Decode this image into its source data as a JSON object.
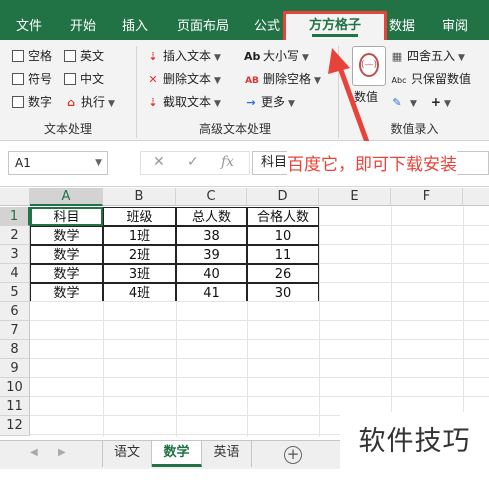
{
  "ribbon_tabs": [
    "文件",
    "开始",
    "插入",
    "页面布局",
    "公式",
    "方方格子",
    "数据",
    "审阅"
  ],
  "text_group": {
    "label": "文本处理",
    "checks": [
      "空格",
      "英文",
      "符号",
      "中文",
      "数字"
    ],
    "execute": "执行"
  },
  "adv_group": {
    "label": "高级文本处理",
    "insert": "插入文本",
    "delete": "删除文本",
    "extract": "截取文本",
    "case": "大小写",
    "delspace": "删除空格",
    "more": "更多",
    "case_icon": "Ab",
    "delspace_icon": "AB"
  },
  "num_group": {
    "label": "数值录入",
    "value": "数值",
    "round": "四舍五入",
    "keep": "只保留数值",
    "round_icon": "Abc"
  },
  "formula_bar": {
    "name": "A1",
    "content": "科目",
    "fx": "fx"
  },
  "annotation": "百度它，即可下载安装",
  "columns": [
    "A",
    "B",
    "C",
    "D",
    "E",
    "F"
  ],
  "rows": [
    "1",
    "2",
    "3",
    "4",
    "5",
    "6",
    "7",
    "8",
    "9",
    "10",
    "11",
    "12"
  ],
  "table": {
    "header": [
      "科目",
      "班级",
      "总人数",
      "合格人数"
    ],
    "body": [
      [
        "数学",
        "1班",
        "38",
        "10"
      ],
      [
        "数学",
        "2班",
        "39",
        "11"
      ],
      [
        "数学",
        "3班",
        "40",
        "26"
      ],
      [
        "数学",
        "4班",
        "41",
        "30"
      ]
    ]
  },
  "sheets": [
    "语文",
    "数学",
    "英语"
  ],
  "active_sheet": "数学",
  "watermark": "软件技巧",
  "colors": {
    "excel_green": "#217346",
    "highlight_red": "#e8433a"
  }
}
